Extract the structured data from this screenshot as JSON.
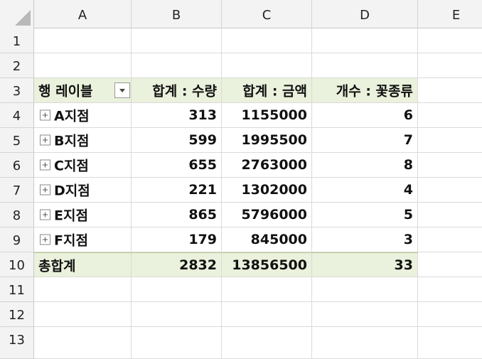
{
  "columns": [
    "A",
    "B",
    "C",
    "D",
    "E"
  ],
  "rows": [
    "1",
    "2",
    "3",
    "4",
    "5",
    "6",
    "7",
    "8",
    "9",
    "10",
    "11",
    "12",
    "13"
  ],
  "pivot": {
    "header": {
      "row_label": "행 레이블",
      "sum_qty": "합계 : 수량",
      "sum_amount": "합계 : 금액",
      "count_flower": "개수 : 꽃종류"
    },
    "items": [
      {
        "label": "A지점",
        "qty": "313",
        "amount": "1155000",
        "count": "6"
      },
      {
        "label": "B지점",
        "qty": "599",
        "amount": "1995500",
        "count": "7"
      },
      {
        "label": "C지점",
        "qty": "655",
        "amount": "2763000",
        "count": "8"
      },
      {
        "label": "D지점",
        "qty": "221",
        "amount": "1302000",
        "count": "4"
      },
      {
        "label": "E지점",
        "qty": "865",
        "amount": "5796000",
        "count": "5"
      },
      {
        "label": "F지점",
        "qty": "179",
        "amount": "845000",
        "count": "3"
      }
    ],
    "total": {
      "label": "총합계",
      "qty": "2832",
      "amount": "13856500",
      "count": "33"
    }
  },
  "colors": {
    "pivot_fill": "#eaf1dc",
    "header_bg": "#f3f3f3",
    "grid": "#dadada"
  }
}
